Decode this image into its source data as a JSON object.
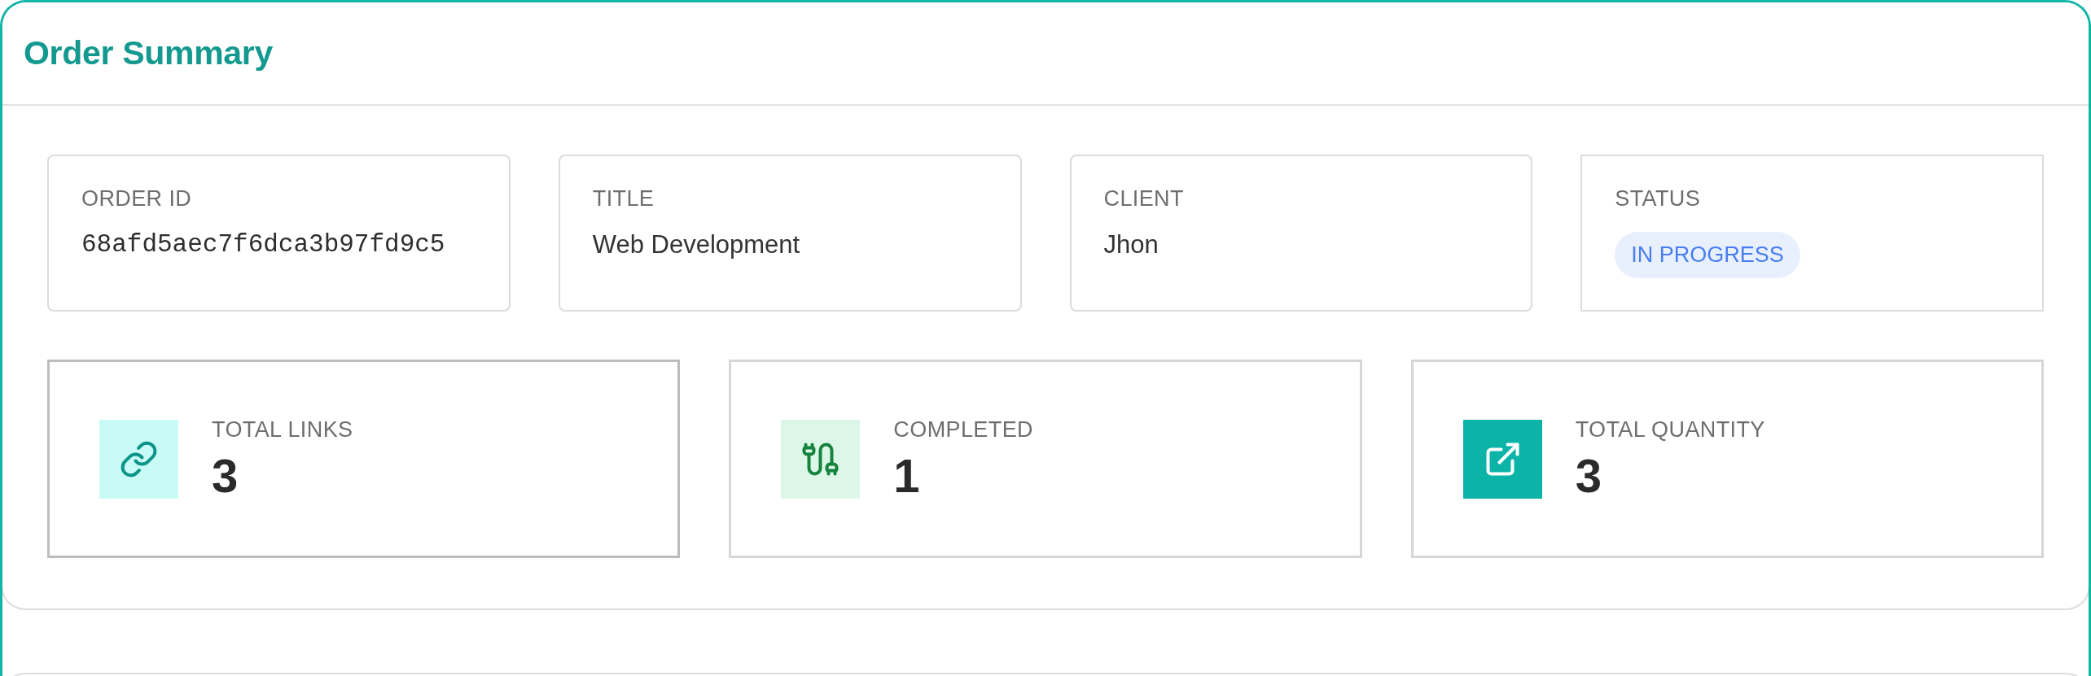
{
  "title": "Order Summary",
  "fields": [
    {
      "kind": "mono",
      "label": "ORDER ID",
      "value": "68afd5aec7f6dca3b97fd9c5"
    },
    {
      "kind": "text",
      "label": "TITLE",
      "value": "Web Development"
    },
    {
      "kind": "text",
      "label": "CLIENT",
      "value": "Jhon"
    },
    {
      "kind": "badge",
      "label": "STATUS",
      "value": "IN PROGRESS"
    }
  ],
  "stats": [
    {
      "kind": "links",
      "label": "TOTAL LINKS",
      "value": "3",
      "selected": true
    },
    {
      "kind": "completed",
      "label": "COMPLETED",
      "value": "1",
      "selected": false
    },
    {
      "kind": "quantity",
      "label": "TOTAL QUANTITY",
      "value": "3",
      "selected": false
    }
  ]
}
